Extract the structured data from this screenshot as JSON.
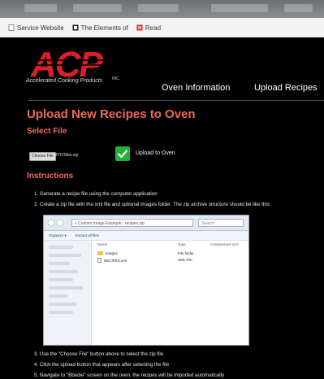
{
  "bookmarks": {
    "items": [
      {
        "label": "Service Website",
        "icon": "page-icon"
      },
      {
        "label": "The Elements of",
        "icon": "book-icon"
      },
      {
        "label": "Read",
        "icon": "bookmark-icon"
      }
    ]
  },
  "brand": {
    "logo_text": "ACP",
    "tagline": "Accelerated Cooking Products",
    "inc": "INC."
  },
  "nav": {
    "items": [
      "Oven Information",
      "Upload Recipes"
    ]
  },
  "content": {
    "title": "Upload New Recipes to Oven",
    "select_file_heading": "Select File",
    "choose_file_label": "Choose File",
    "selected_file_name": "MYFOlder.zip",
    "upload_label": "Upload to Oven",
    "instructions_heading": "Instructions",
    "steps": [
      "1. Generate a recipe file using the computer application",
      "2. Create a zip file with the xml file and optional images folder. The zip archive structure should be like this:",
      "3. Use the \"Choose File\" button above to select the zip file",
      "4. Click the upload button that appears after selecting the file",
      "5. Navigate to \"Bbedie\" screen on the oven. the recipes will be imported automatically"
    ]
  },
  "explorer": {
    "path": "« Custom Image Example › recipes.zip",
    "search_placeholder": "Search",
    "toolbar": [
      "Organize ▾",
      "Extract all files"
    ],
    "columns": [
      "Name",
      "Type",
      "Compressed size"
    ],
    "rows": [
      {
        "name": "Images",
        "type": "File folder",
        "kind": "folder"
      },
      {
        "name": "RECIPES.xml",
        "type": "XML File",
        "kind": "file"
      }
    ]
  },
  "colors": {
    "accent": "#ef6a5a",
    "logo_red": "#d8202a",
    "upload_green": "#23b038"
  }
}
